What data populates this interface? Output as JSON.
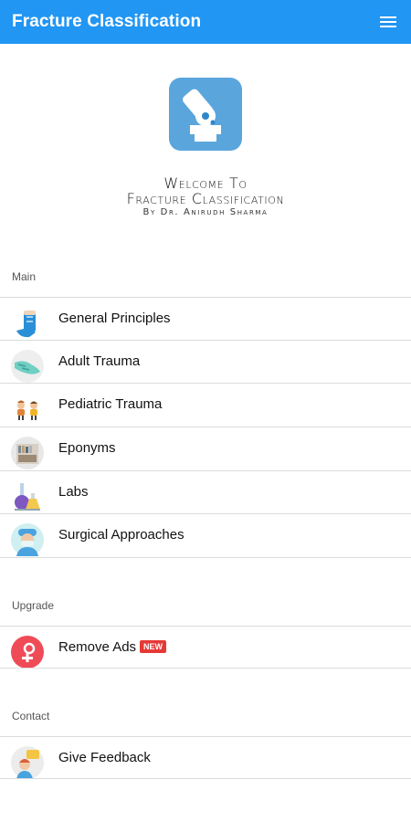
{
  "appbar": {
    "title": "Fracture Classification",
    "menu_icon": "hamburger-menu-icon"
  },
  "welcome": {
    "line1": "Welcome To",
    "line2": "Fracture Classification",
    "byline": "By Dr. Anirudh Sharma"
  },
  "sections": {
    "main": {
      "header": "Main",
      "items": [
        {
          "label": "General Principles",
          "icon": "cast-arm-icon"
        },
        {
          "label": "Adult Trauma",
          "icon": "foot-bandage-icon"
        },
        {
          "label": "Pediatric Trauma",
          "icon": "children-icon"
        },
        {
          "label": "Eponyms",
          "icon": "bookshelf-icon"
        },
        {
          "label": "Labs",
          "icon": "lab-flasks-icon"
        },
        {
          "label": "Surgical Approaches",
          "icon": "surgeon-icon"
        }
      ]
    },
    "upgrade": {
      "header": "Upgrade",
      "items": [
        {
          "label": "Remove Ads",
          "badge": "NEW",
          "icon": "no-ads-icon"
        }
      ]
    },
    "contact": {
      "header": "Contact",
      "items": [
        {
          "label": "Give Feedback",
          "icon": "feedback-person-icon"
        }
      ]
    }
  },
  "colors": {
    "appbar": "#2196f3",
    "logo_bg": "#5aa6dc",
    "badge": "#e53935"
  }
}
